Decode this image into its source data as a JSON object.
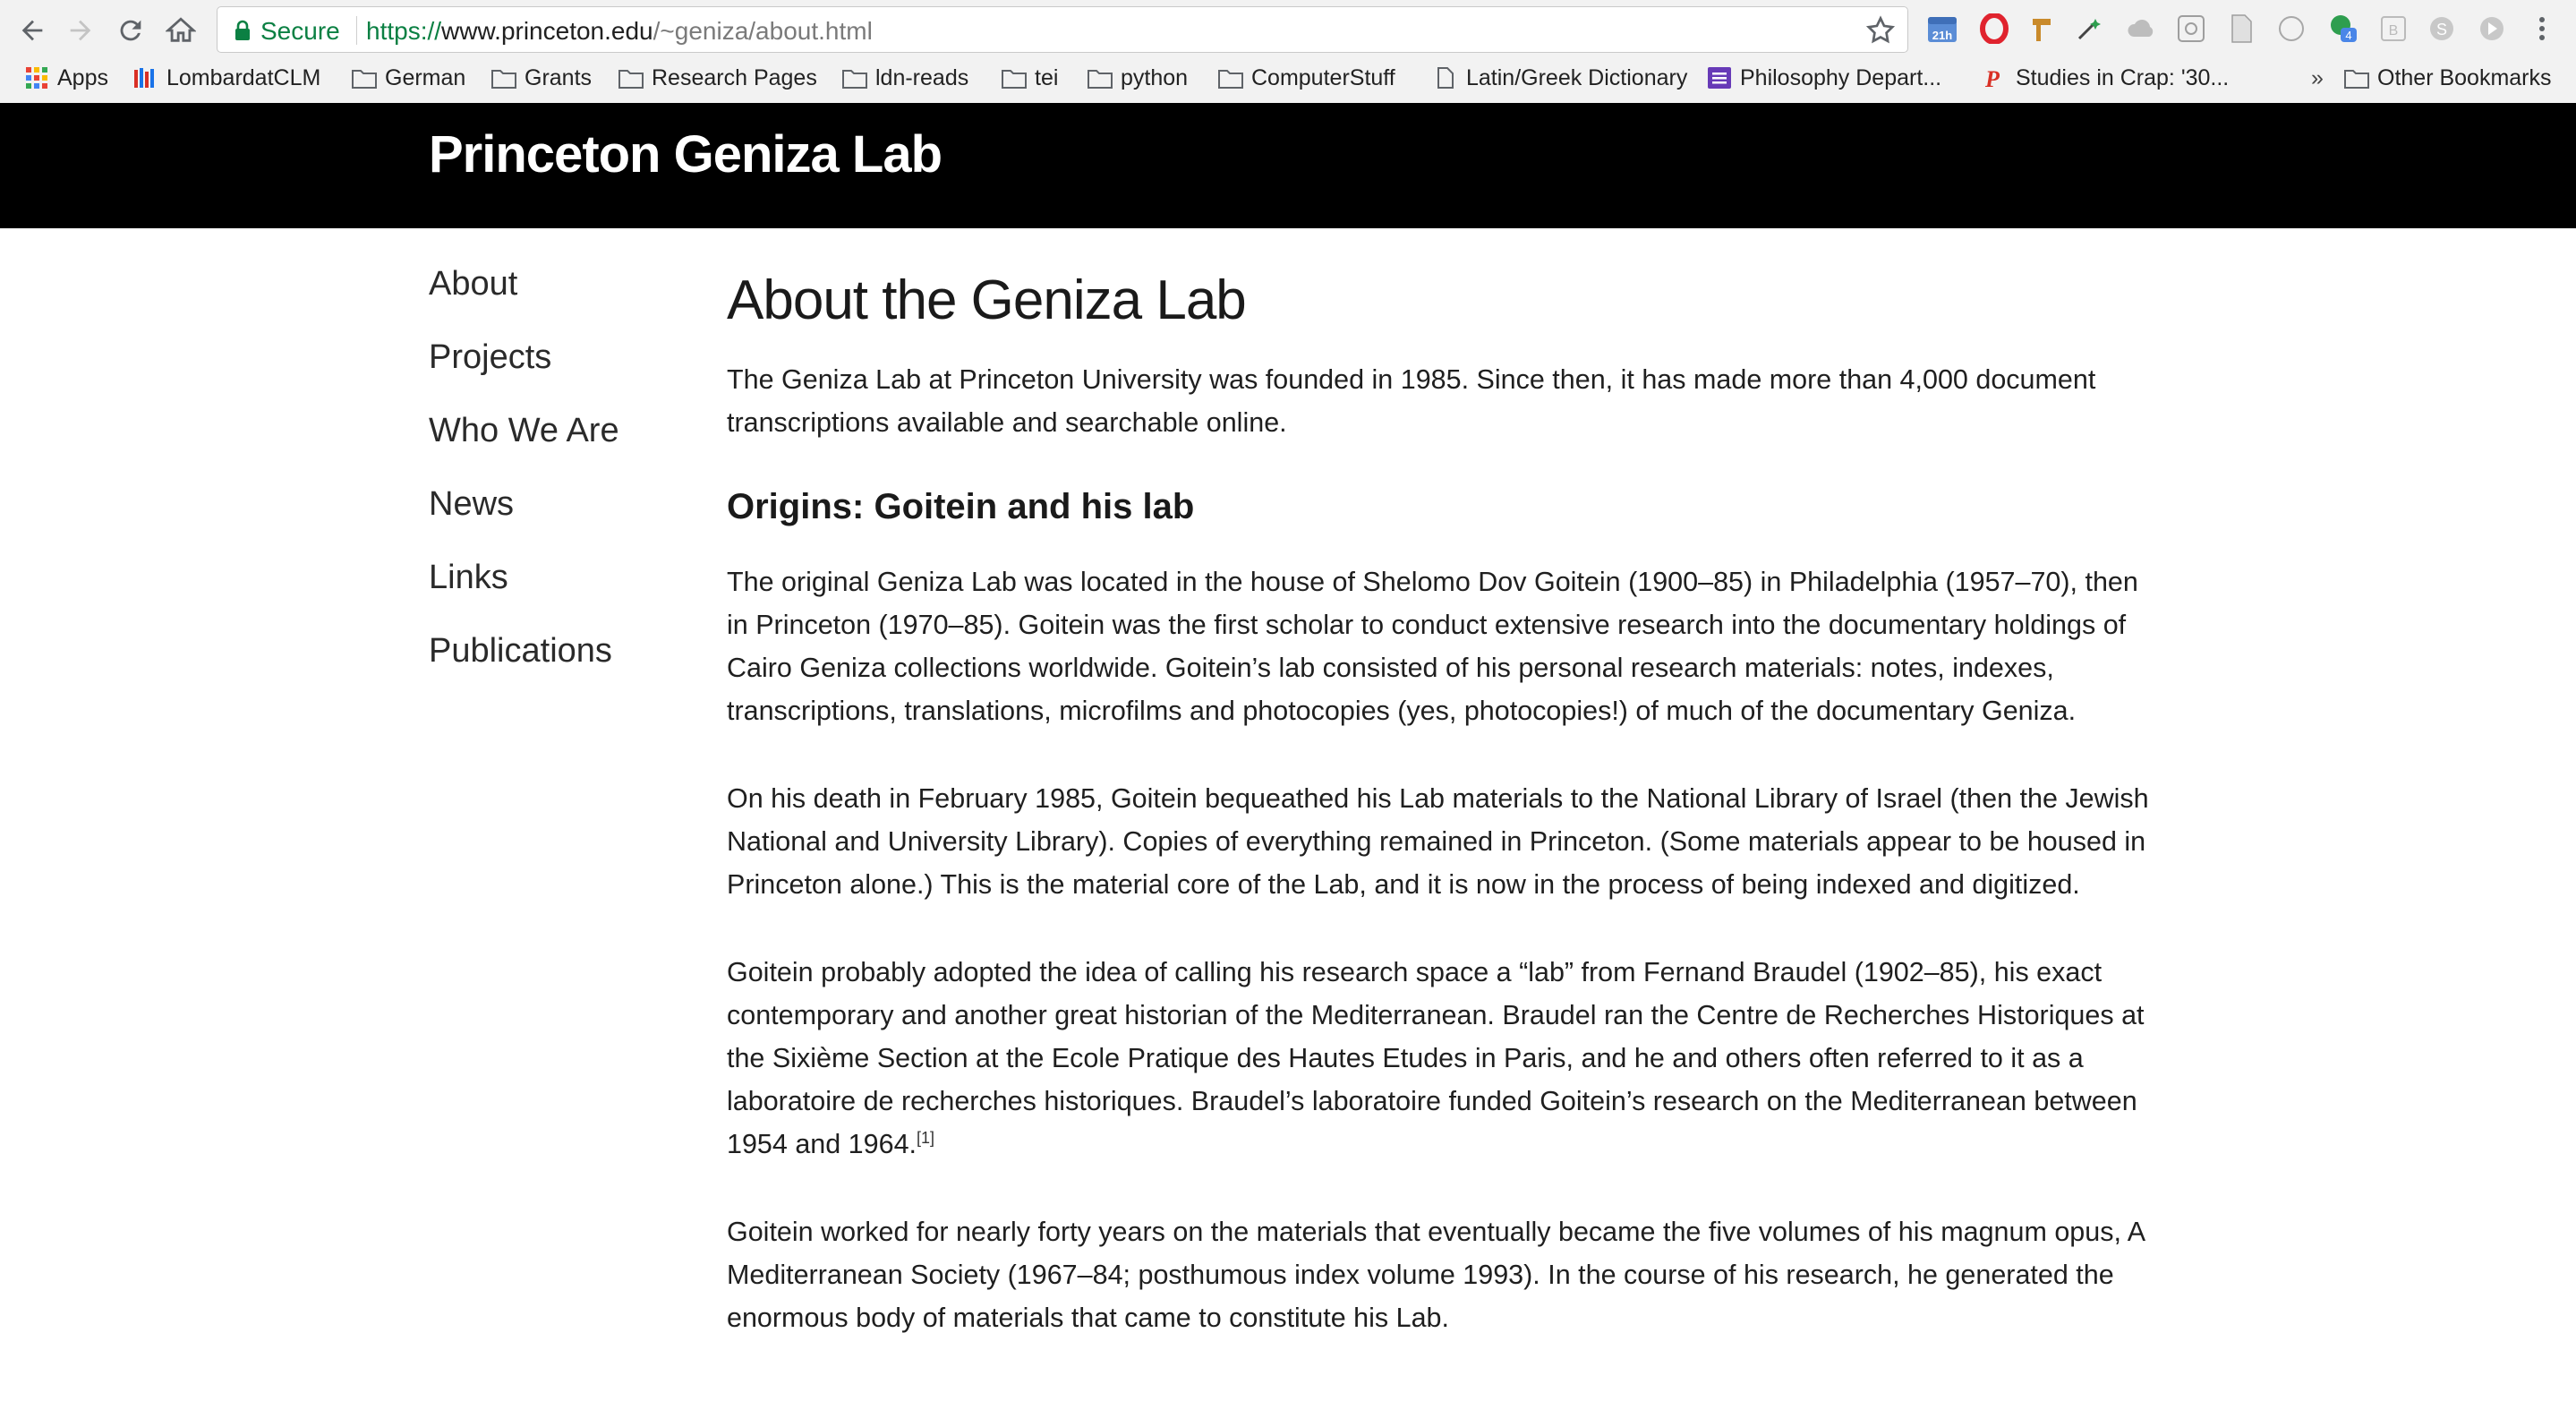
{
  "browser": {
    "secure_label": "Secure",
    "url_scheme": "https://",
    "url_host": "www.princeton.edu",
    "url_path": "/~geniza/about.html",
    "calendar_badge": "21h",
    "notification_count": "4",
    "bookmarks": [
      {
        "label": "Apps",
        "icon": "apps-grid-icon"
      },
      {
        "label": "LombardatCLM",
        "icon": "library-icon"
      },
      {
        "label": "German",
        "icon": "folder-icon"
      },
      {
        "label": "Grants",
        "icon": "folder-icon"
      },
      {
        "label": "Research Pages",
        "icon": "folder-icon"
      },
      {
        "label": "ldn-reads",
        "icon": "folder-icon"
      },
      {
        "label": "tei",
        "icon": "folder-icon"
      },
      {
        "label": "python",
        "icon": "folder-icon"
      },
      {
        "label": "ComputerStuff",
        "icon": "folder-icon"
      },
      {
        "label": "Latin/Greek Dictionary",
        "icon": "page-icon"
      },
      {
        "label": "Philosophy Depart...",
        "icon": "list-icon"
      },
      {
        "label": "Studies in Crap: '30...",
        "icon": "p-logo-icon"
      }
    ],
    "overflow_label": "»",
    "other_bookmarks": "Other Bookmarks"
  },
  "site": {
    "title": "Princeton Geniza Lab"
  },
  "sidebar": {
    "items": [
      "About",
      "Projects",
      "Who We Are",
      "News",
      "Links",
      "Publications"
    ]
  },
  "main": {
    "title": "About the Geniza Lab",
    "intro": "The Geniza Lab at Princeton University was founded in 1985. Since then, it has made more than 4,000 document transcriptions available and searchable online.",
    "section_title": "Origins: Goitein and his lab",
    "paragraphs": [
      "The original Geniza Lab was located in the house of Shelomo Dov Goitein (1900–85) in Philadelphia (1957–70), then in Princeton (1970–85). Goitein was the first scholar to conduct extensive research into the documentary holdings of Cairo Geniza collections worldwide. Goitein’s lab consisted of his personal research materials: notes, indexes, transcriptions, translations, microfilms and photocopies (yes, photocopies!) of much of the documentary Geniza.",
      "On his death in February 1985, Goitein bequeathed his Lab materials to the National Library of Israel (then the Jewish National and University Library). Copies of everything remained in Princeton. (Some materials appear to be housed in Princeton alone.) This is the material core of the Lab, and it is now in the process of being indexed and digitized.",
      "Goitein probably adopted the idea of calling his research space a “lab” from Fernand Braudel (1902–85), his exact contemporary and another great historian of the Mediterranean. Braudel ran the Centre de Recherches Historiques at the Sixième Section at the Ecole Pratique des Hautes Etudes in Paris, and he and others often referred to it as a laboratoire de recherches historiques. Braudel’s laboratoire funded Goitein’s research on the Mediterranean between 1954 and 1964.",
      "Goitein worked for nearly forty years on the materials that eventually became the five volumes of his magnum opus, A Mediterranean Society (1967–84; posthumous index volume 1993). In the course of his research, he generated the enormous body of materials that came to constitute his Lab."
    ],
    "footnote_marker": "[1]"
  },
  "colors": {
    "secure_green": "#0b8043",
    "header_bg": "#000000",
    "header_text": "#ffffff",
    "body_text": "#1f1f1f"
  }
}
